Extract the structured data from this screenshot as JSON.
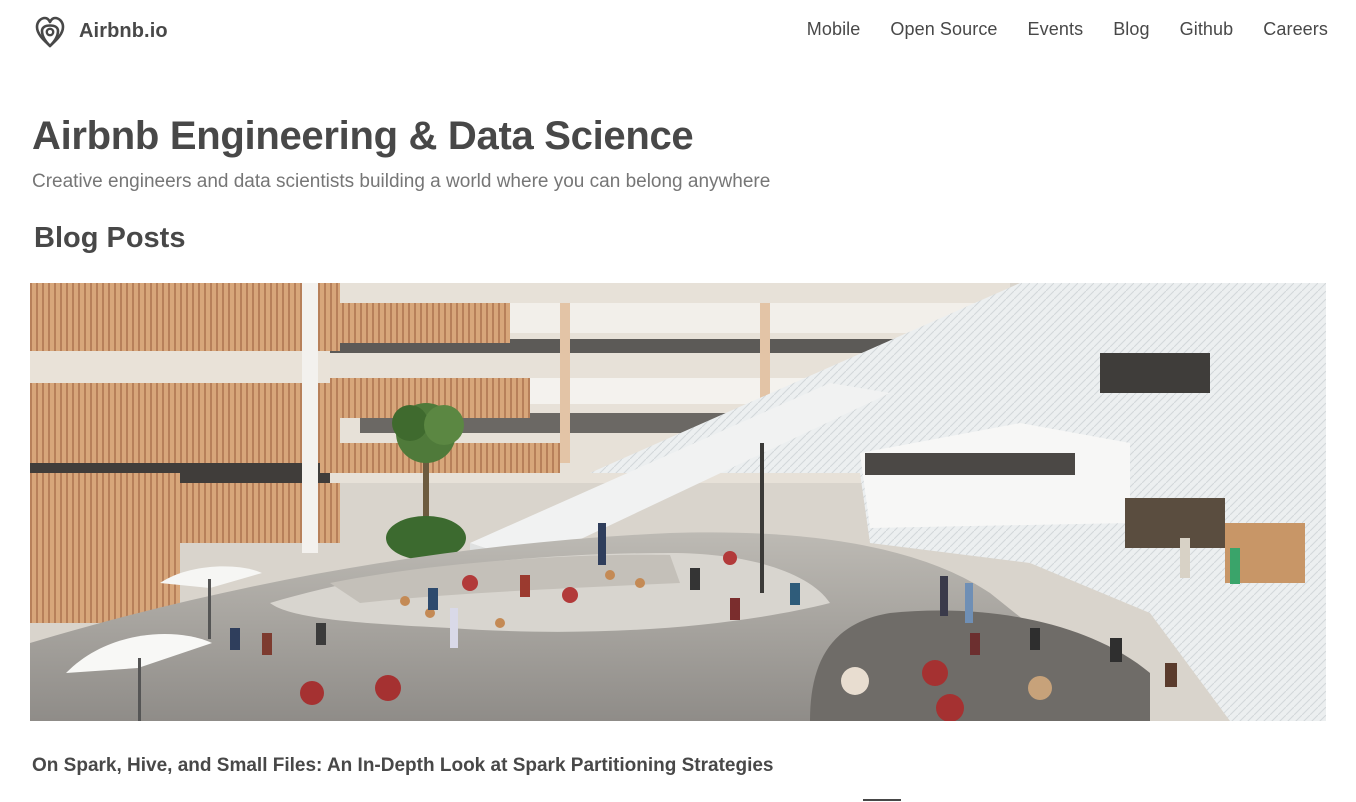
{
  "header": {
    "brand_name": "Airbnb.io",
    "logo_icon": "airbnb-belo-logo",
    "nav": [
      {
        "label": "Mobile"
      },
      {
        "label": "Open Source"
      },
      {
        "label": "Events"
      },
      {
        "label": "Blog"
      },
      {
        "label": "Github"
      },
      {
        "label": "Careers"
      }
    ]
  },
  "hero": {
    "title": "Airbnb Engineering & Data Science",
    "subtitle": "Creative engineers and data scientists building a world where you can belong anywhere"
  },
  "blog": {
    "section_title": "Blog Posts",
    "posts": [
      {
        "image_subject": "office-atrium-photo",
        "title": "On Spark, Hive, and Small Files: An In-Depth Look at Spark Partitioning Strategies"
      }
    ]
  },
  "colors": {
    "text": "#484848",
    "muted": "#767676",
    "background": "#ffffff"
  }
}
